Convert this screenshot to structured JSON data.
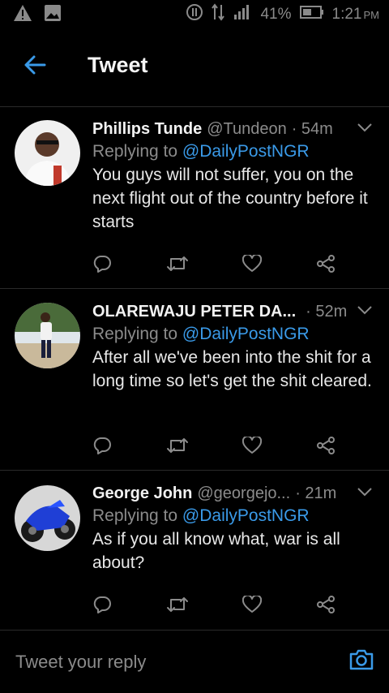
{
  "status_bar": {
    "battery": "41%",
    "time": "1:21",
    "ampm": "PM",
    "icons": [
      "warning-icon",
      "image-icon",
      "sync-icon",
      "data-arrows-icon",
      "signal-icon",
      "battery-icon"
    ]
  },
  "header": {
    "title": "Tweet"
  },
  "tweets": [
    {
      "name": "Phillips Tunde",
      "handle": "@Tundeon",
      "time": "· 54m",
      "replying_prefix": "Replying to",
      "replying_to": "@DailyPostNGR",
      "text": "You guys will not suffer, you on the next flight out of the country before it starts"
    },
    {
      "name": "OLAREWAJU PETER DA...",
      "handle": "",
      "time": "· 52m",
      "replying_prefix": "Replying to",
      "replying_to": "@DailyPostNGR",
      "text": "After all we've been into the shit for a long time so let's get the shit cleared."
    },
    {
      "name": "George John",
      "handle": "@georgejo...",
      "time": "· 21m",
      "replying_prefix": "Replying to",
      "replying_to": "@DailyPostNGR",
      "text": "As if you all know what, war is all about?"
    }
  ],
  "composer": {
    "placeholder": "Tweet your reply"
  },
  "colors": {
    "accent": "#3a9ae8",
    "background": "#000000",
    "muted": "#8b8b8b"
  }
}
